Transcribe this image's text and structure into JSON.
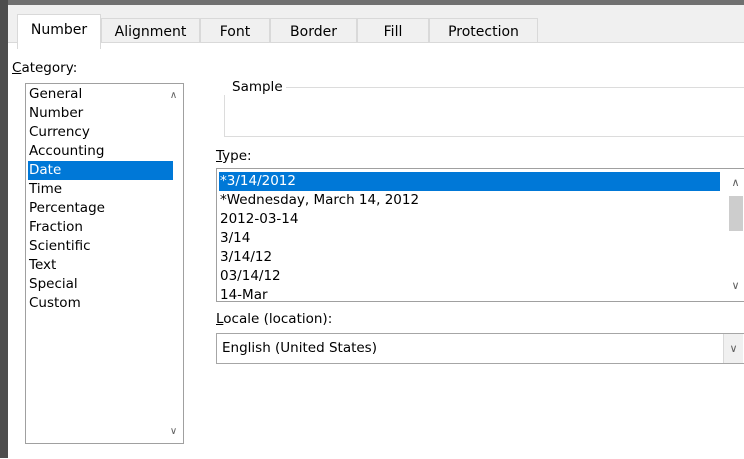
{
  "tabs": [
    {
      "label": "Number"
    },
    {
      "label": "Alignment"
    },
    {
      "label": "Font"
    },
    {
      "label": "Border"
    },
    {
      "label": "Fill"
    },
    {
      "label": "Protection"
    }
  ],
  "category": {
    "label_first": "C",
    "label_rest": "ategory:",
    "items": [
      "General",
      "Number",
      "Currency",
      "Accounting",
      "Date",
      "Time",
      "Percentage",
      "Fraction",
      "Scientific",
      "Text",
      "Special",
      "Custom"
    ],
    "selected": "Date"
  },
  "sample": {
    "label": "Sample"
  },
  "type": {
    "label_first": "T",
    "label_rest": "ype:",
    "items": [
      "*3/14/2012",
      "*Wednesday, March 14, 2012",
      "2012-03-14",
      "3/14",
      "3/14/12",
      "03/14/12",
      "14-Mar"
    ],
    "selected": "*3/14/2012"
  },
  "locale": {
    "label_first": "L",
    "label_rest": "ocale (location):",
    "value": "English (United States)"
  },
  "icons": {
    "scroll_up": "chevron-up",
    "scroll_down": "chevron-down",
    "dropdown": "chevron-down"
  }
}
